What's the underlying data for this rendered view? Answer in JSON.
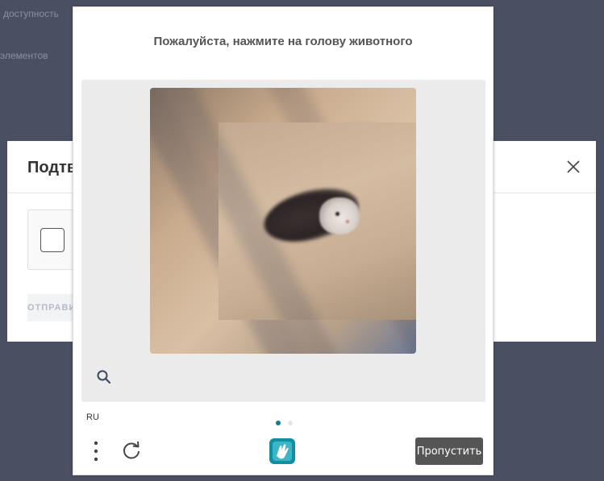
{
  "background": {
    "line_1": "доступность",
    "line_2": "элементов"
  },
  "confirm_modal": {
    "title": "Подтвердите",
    "submit_label": "ОТПРАВИТЬ"
  },
  "challenge": {
    "prompt": "Пожалуйста, нажмите на голову животного",
    "language": "RU",
    "skip_label": "Пропустить",
    "page_indicator": {
      "current": 1,
      "total": 2
    },
    "icons": [
      "search-icon",
      "kebab-menu-icon",
      "refresh-icon",
      "hcaptcha-logo-icon"
    ]
  },
  "colors": {
    "overlay": "#4a5062",
    "skip_button": "#555555",
    "dot_active": "#0f7f8f",
    "dot_inactive": "#e0e0e0"
  }
}
